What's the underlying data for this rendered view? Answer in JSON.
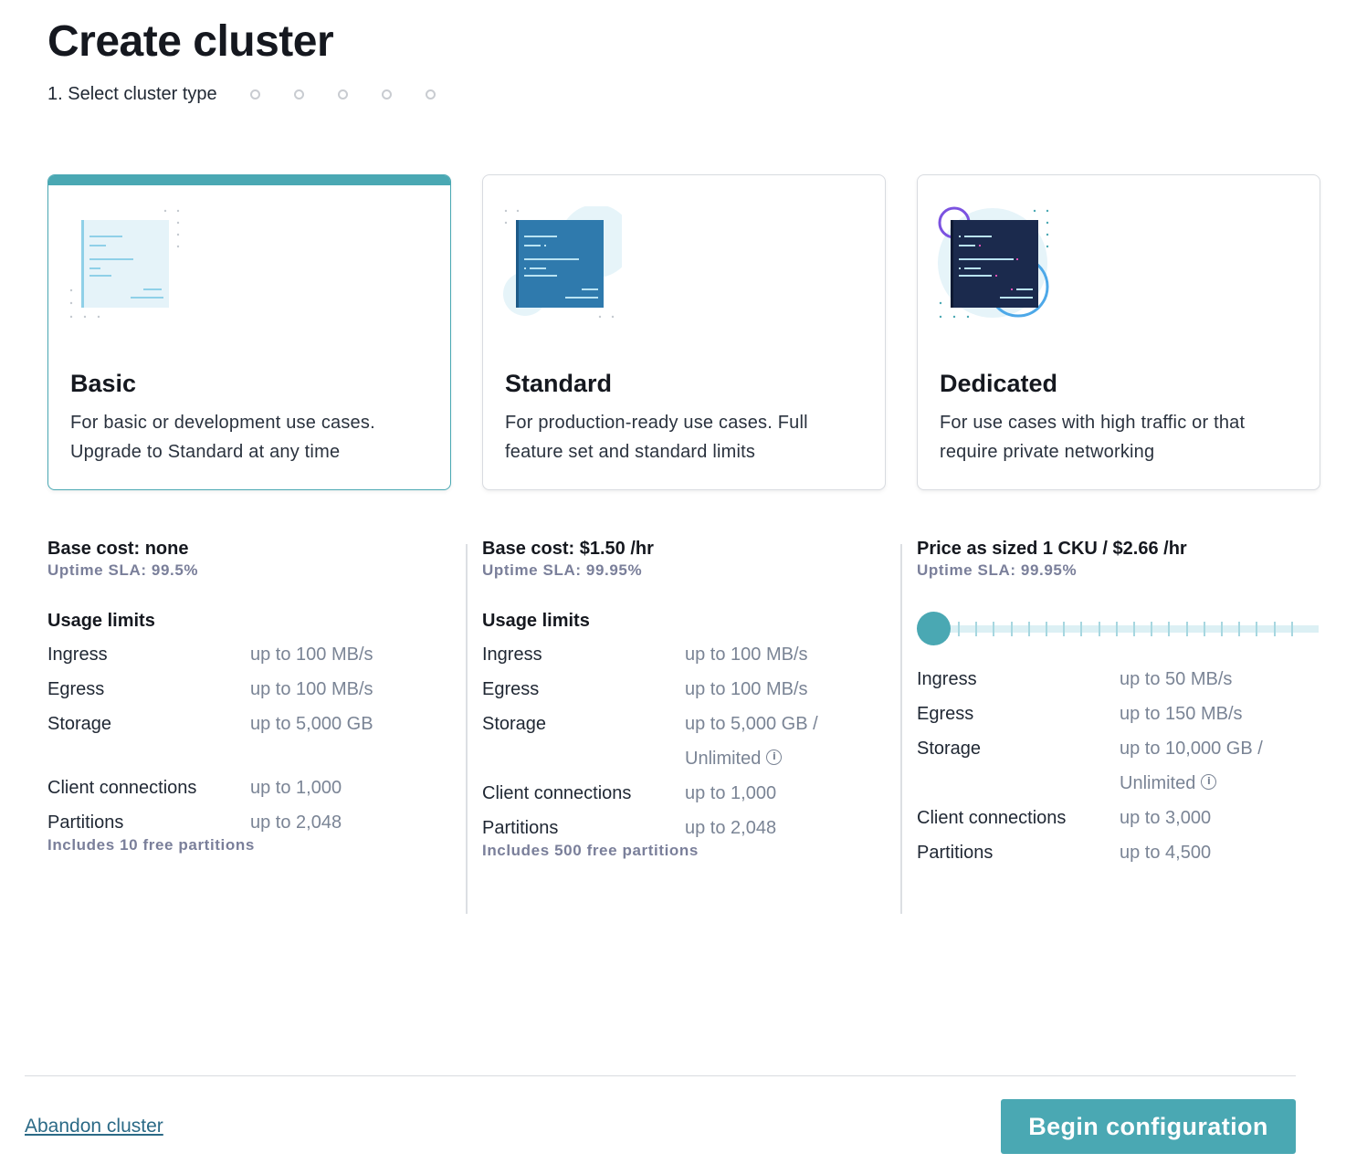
{
  "page": {
    "title": "Create cluster",
    "step_label": "1. Select cluster type"
  },
  "cards": [
    {
      "title": "Basic",
      "description": "For basic or development use cases. Upgrade to Standard at any time",
      "selected": true
    },
    {
      "title": "Standard",
      "description": "For production-ready use cases. Full feature set and standard limits",
      "selected": false
    },
    {
      "title": "Dedicated",
      "description": "For use cases with high traffic or that require private networking",
      "selected": false
    }
  ],
  "details": {
    "basic": {
      "cost": "Base cost: none",
      "sla": "Uptime SLA: 99.5%",
      "usage_heading": "Usage limits",
      "ingress_label": "Ingress",
      "ingress_value": "up to 100 MB/s",
      "egress_label": "Egress",
      "egress_value": "up to 100 MB/s",
      "storage_label": "Storage",
      "storage_value": "up to 5,000 GB",
      "clients_label": "Client connections",
      "clients_value": "up to 1,000",
      "partitions_label": "Partitions",
      "partitions_value": "up to 2,048",
      "note": "Includes 10 free partitions"
    },
    "standard": {
      "cost": "Base cost: $1.50 /hr",
      "sla": "Uptime SLA: 99.95%",
      "usage_heading": "Usage limits",
      "ingress_label": "Ingress",
      "ingress_value": "up to 100 MB/s",
      "egress_label": "Egress",
      "egress_value": "up to 100 MB/s",
      "storage_label": "Storage",
      "storage_value": "up to 5,000 GB /",
      "storage_value_2": "Unlimited",
      "clients_label": "Client connections",
      "clients_value": "up to 1,000",
      "partitions_label": "Partitions",
      "partitions_value": "up to 2,048",
      "note": "Includes 500 free partitions"
    },
    "dedicated": {
      "cost": "Price as sized 1 CKU / $2.66 /hr",
      "sla": "Uptime SLA: 99.95%",
      "slider_position": 0,
      "ingress_label": "Ingress",
      "ingress_value": "up to 50 MB/s",
      "egress_label": "Egress",
      "egress_value": "up to 150 MB/s",
      "storage_label": "Storage",
      "storage_value": "up to 10,000 GB /",
      "storage_value_2": "Unlimited",
      "clients_label": "Client connections",
      "clients_value": "up to 3,000",
      "partitions_label": "Partitions",
      "partitions_value": "up to 4,500"
    }
  },
  "footer": {
    "abandon_label": "Abandon cluster",
    "begin_label": "Begin configuration"
  },
  "colors": {
    "accent": "#4aa8b3",
    "link": "#2b6a86",
    "muted": "#7a8495"
  },
  "icons": {
    "info": "info-icon",
    "step": "step-dot"
  }
}
